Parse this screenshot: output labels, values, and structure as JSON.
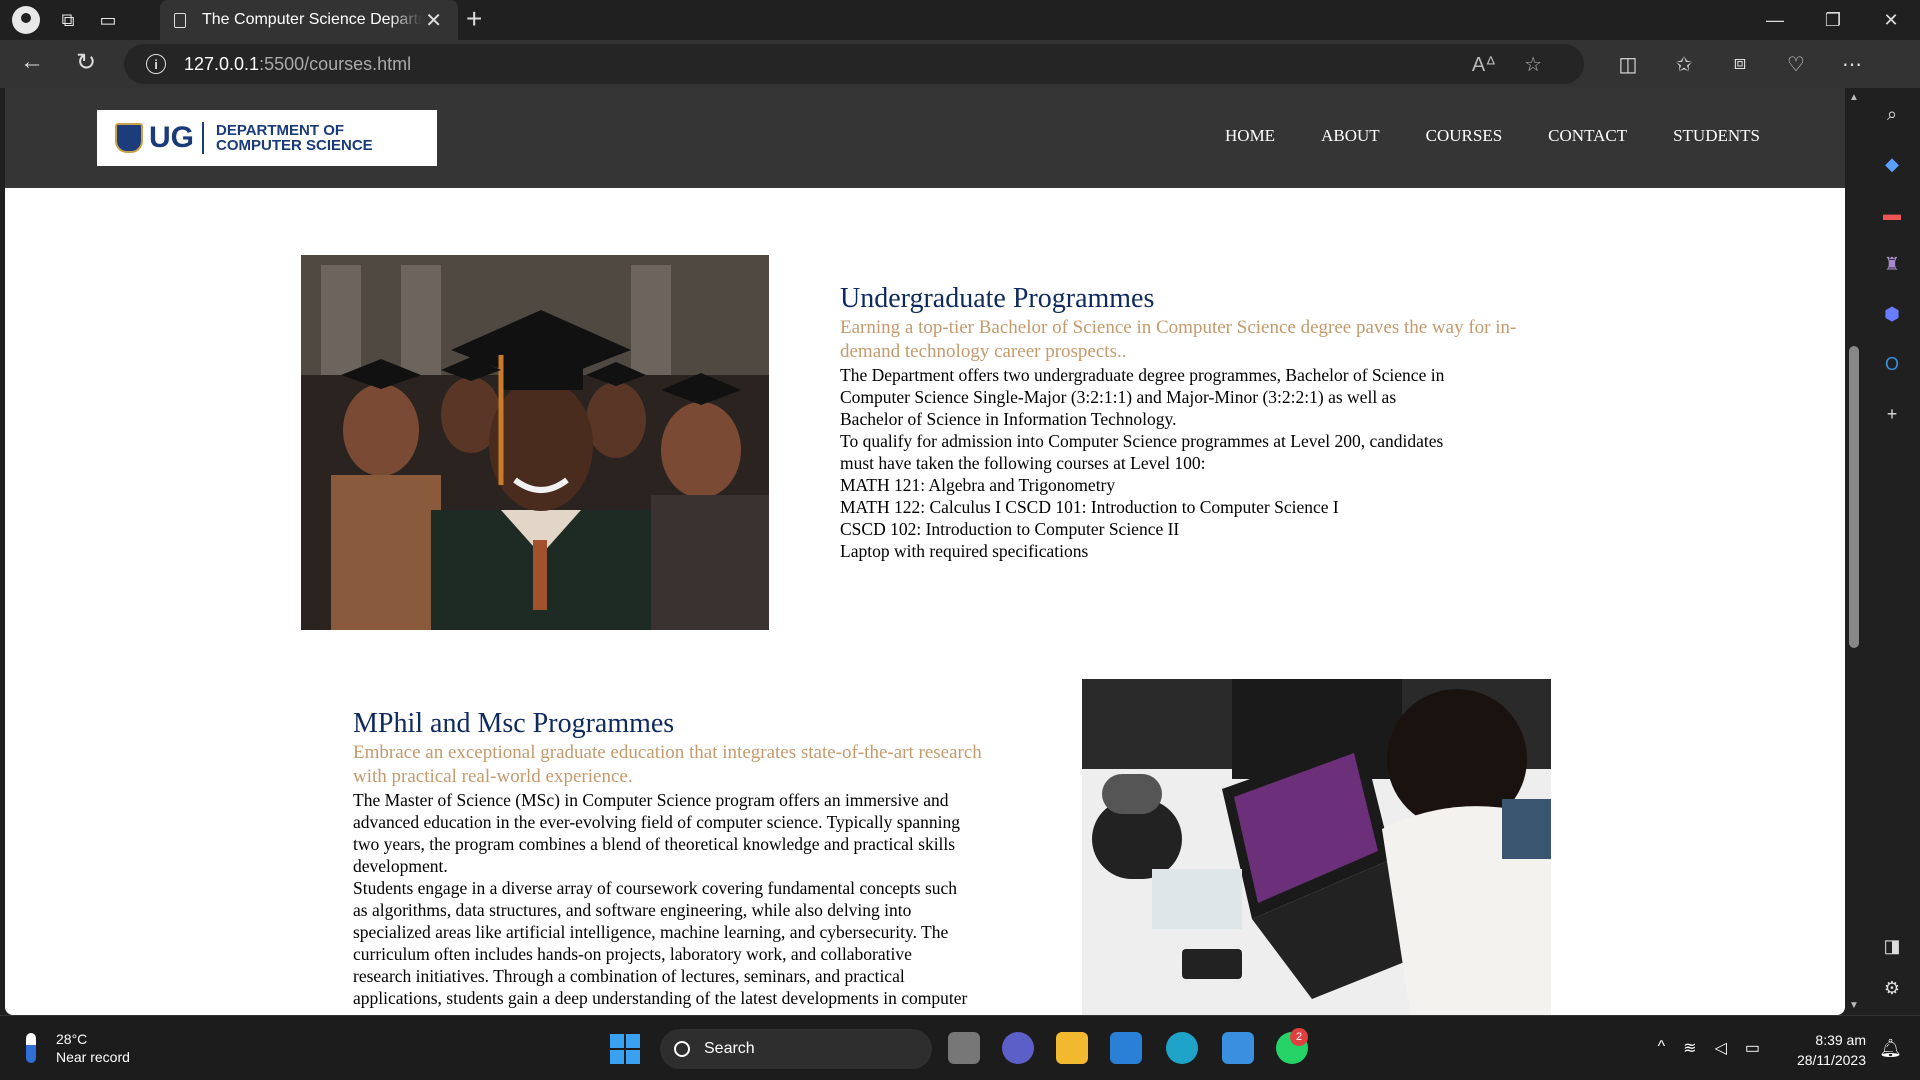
{
  "browser": {
    "tab_title": "The Computer Science Department",
    "url_host": "127.0.0.1",
    "url_path": ":5500/courses.html"
  },
  "site": {
    "logo_ug": "UG",
    "logo_dept_line1": "DEPARTMENT OF",
    "logo_dept_line2": "COMPUTER SCIENCE",
    "nav": [
      "HOME",
      "ABOUT",
      "COURSES",
      "CONTACT",
      "STUDENTS"
    ]
  },
  "sections": {
    "undergrad": {
      "title": "Undergraduate Programmes",
      "subtitle": "Earning a top-tier Bachelor of Science in Computer Science degree paves the way for in-demand technology career prospects..",
      "lines": [
        "The Department offers two undergraduate degree programmes, Bachelor of Science in",
        "Computer Science Single-Major (3:2:1:1) and Major-Minor (3:2:2:1) as well as",
        "Bachelor of Science in Information Technology.",
        "To qualify for admission into Computer Science programmes at Level 200, candidates",
        "must have taken the following courses at Level 100:",
        "MATH 121: Algebra and Trigonometry",
        "MATH 122: Calculus I CSCD 101: Introduction to Computer Science I",
        "CSCD 102: Introduction to Computer Science II",
        "Laptop with required specifications"
      ]
    },
    "grad": {
      "title": "MPhil and Msc Programmes",
      "subtitle": "Embrace an exceptional graduate education that integrates state-of-the-art research with practical real-world experience.",
      "lines": [
        "The Master of Science (MSc) in Computer Science program offers an immersive and",
        "advanced education in the ever-evolving field of computer science. Typically spanning",
        "two years, the program combines a blend of theoretical knowledge and practical skills",
        "development.",
        "Students engage in a diverse array of coursework covering fundamental concepts such",
        "as algorithms, data structures, and software engineering, while also delving into",
        "specialized areas like artificial intelligence, machine learning, and cybersecurity. The",
        "curriculum often includes hands-on projects, laboratory work, and collaborative",
        "research initiatives. Through a combination of lectures, seminars, and practical",
        "applications, students gain a deep understanding of the latest developments in computer"
      ]
    }
  },
  "taskbar": {
    "temp": "28°C",
    "weather": "Near record",
    "search": "Search",
    "badge": "2",
    "time": "8:39 am",
    "date": "28/11/2023"
  },
  "colors": {
    "title_navy": "#0f2a5e",
    "subtitle_tan": "#c49a6c",
    "header_bg": "#353535"
  }
}
